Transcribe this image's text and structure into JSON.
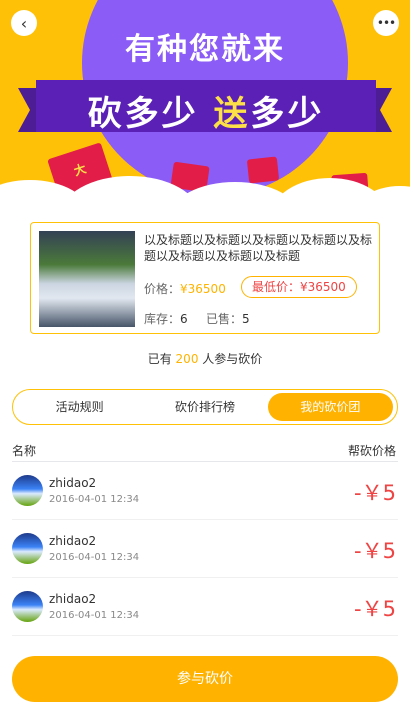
{
  "banner": {
    "title_line1": "有种您就来",
    "title_part1": "砍多少",
    "title_highlight": "送",
    "title_part2": "多少",
    "envelope_text": "大",
    "accent_color": "#ffc107",
    "circle_color": "#8b5cf6"
  },
  "nav": {
    "back_icon": "chevron-left-icon",
    "more_icon": "more-dots-icon"
  },
  "product": {
    "title": "以及标题以及标题以及标题以及标题以及标题以及标题以及标题以及标题",
    "price_label": "价格：",
    "price_value": "¥36500",
    "min_price_text": "最低价：¥36500",
    "stock_label": "库存：",
    "stock_value": "6",
    "sold_label": "已售：",
    "sold_value": "5"
  },
  "participants": {
    "prefix": "已有",
    "count": "200",
    "suffix": "人参与砍价"
  },
  "tabs": [
    {
      "label": "活动规则",
      "active": false
    },
    {
      "label": "砍价排行榜",
      "active": false
    },
    {
      "label": "我的砍价团",
      "active": true
    }
  ],
  "list": {
    "col_name": "名称",
    "col_price": "帮砍价格",
    "rows": [
      {
        "name": "zhidao2",
        "time": "2016-04-01 12:34",
        "amount": "-￥5"
      },
      {
        "name": "zhidao2",
        "time": "2016-04-01 12:34",
        "amount": "-￥5"
      },
      {
        "name": "zhidao2",
        "time": "2016-04-01 12:34",
        "amount": "-￥5"
      }
    ]
  },
  "cta": {
    "label": "参与砍价",
    "color": "#ffb300"
  }
}
